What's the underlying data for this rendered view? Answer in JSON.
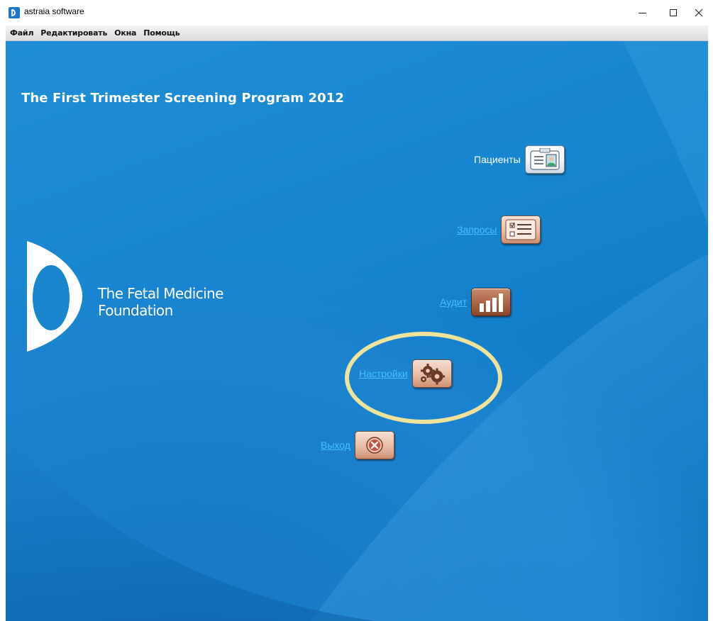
{
  "window": {
    "title": "astraia software",
    "controls": [
      "minimize",
      "maximize",
      "close"
    ]
  },
  "menubar": {
    "items": [
      "Файл",
      "Редактировать",
      "Окна",
      "Помощь"
    ]
  },
  "main": {
    "program_title": "The First Trimester Screening Program 2012",
    "logo": {
      "line1": "The Fetal Medicine",
      "line2": "Foundation"
    },
    "entries": [
      {
        "label": "Пациенты",
        "icon": "patient-card-icon"
      },
      {
        "label": "Запросы",
        "icon": "checklist-icon"
      },
      {
        "label": "Аудит",
        "icon": "bar-chart-icon"
      },
      {
        "label": "Настройки",
        "icon": "gears-icon",
        "highlighted": true
      },
      {
        "label": "Выход",
        "icon": "exit-x-icon"
      }
    ]
  },
  "colors": {
    "background_blue": "#1685cf",
    "link_blue": "#44c2ff",
    "highlight_ring": "#efe29a",
    "tile_base": "#e7b9a1"
  }
}
